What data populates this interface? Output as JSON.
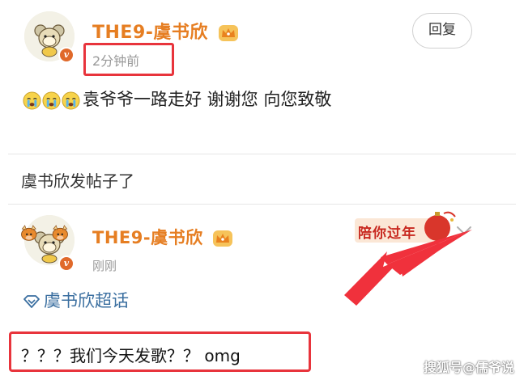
{
  "post1": {
    "username": "THE9-虞书欣",
    "timestamp": "2分钟前",
    "reply_label": "回复",
    "text": "袁爷爷一路走好 谢谢您 向您致敬",
    "emoji_icons": [
      "cry-emoji",
      "cry-emoji",
      "cry-emoji"
    ]
  },
  "section_title": "虞书欣发帖子了",
  "post2": {
    "username": "THE9-虞书欣",
    "timestamp": "刚刚",
    "banner_text": "陪你过年",
    "topic": "虞书欣超话",
    "text": "？？？我们今天发歌？？ omg"
  },
  "watermark": "搜狐号@儒爷说",
  "colors": {
    "username": "#e67e22",
    "highlight": "#e8343c",
    "topic_link": "#3b6fa0",
    "verified_badge": "#e0692a"
  }
}
